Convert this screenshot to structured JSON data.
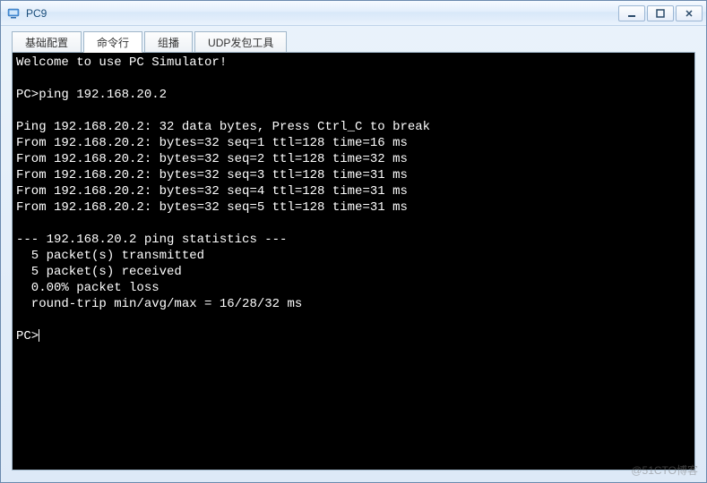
{
  "window": {
    "title": "PC9"
  },
  "tabs": [
    {
      "label": "基础配置"
    },
    {
      "label": "命令行"
    },
    {
      "label": "组播"
    },
    {
      "label": "UDP发包工具"
    }
  ],
  "terminal": {
    "welcome": "Welcome to use PC Simulator!",
    "prompt": "PC>",
    "command": "ping 192.168.20.2",
    "ping_header": "Ping 192.168.20.2: 32 data bytes, Press Ctrl_C to break",
    "replies": [
      "From 192.168.20.2: bytes=32 seq=1 ttl=128 time=16 ms",
      "From 192.168.20.2: bytes=32 seq=2 ttl=128 time=32 ms",
      "From 192.168.20.2: bytes=32 seq=3 ttl=128 time=31 ms",
      "From 192.168.20.2: bytes=32 seq=4 ttl=128 time=31 ms",
      "From 192.168.20.2: bytes=32 seq=5 ttl=128 time=31 ms"
    ],
    "stats_header": "--- 192.168.20.2 ping statistics ---",
    "stats": [
      "  5 packet(s) transmitted",
      "  5 packet(s) received",
      "  0.00% packet loss",
      "  round-trip min/avg/max = 16/28/32 ms"
    ]
  },
  "watermark": "@51CTO博客"
}
